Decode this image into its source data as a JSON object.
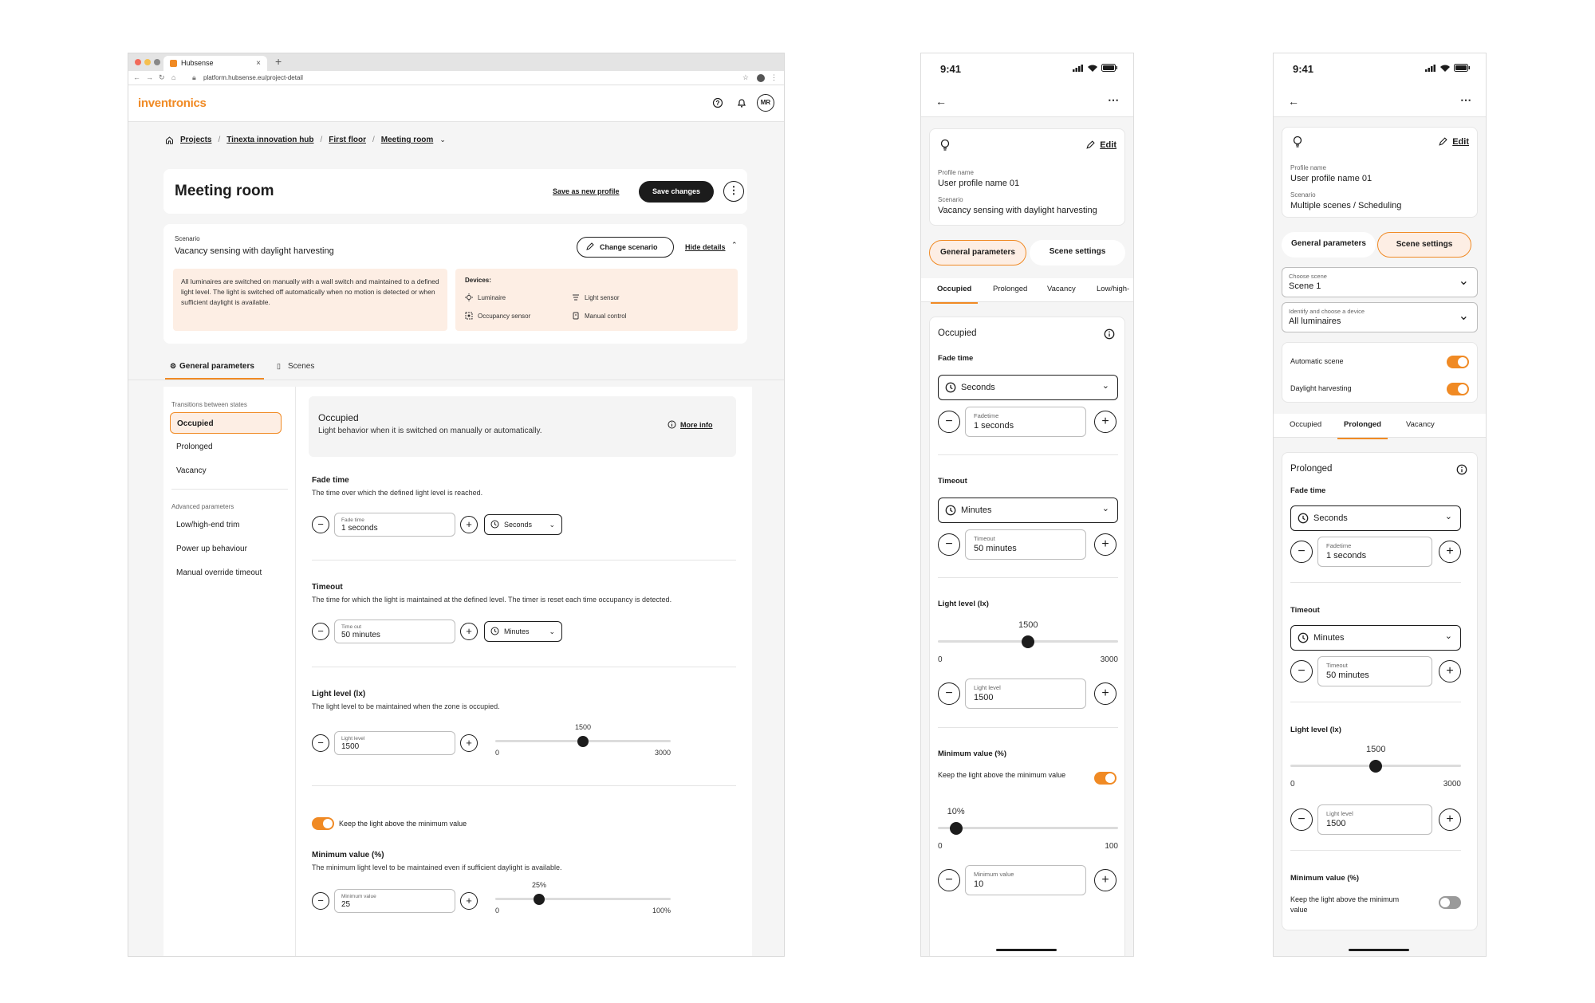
{
  "desktop": {
    "browser": {
      "tab_title": "Hubsense",
      "url": "platform.hubsense.eu/project-detail"
    },
    "logo": "inventronics",
    "avatar": "MR",
    "breadcrumb": [
      "Projects",
      "Tinexta innovation hub",
      "First floor",
      "Meeting room"
    ],
    "page_title": "Meeting room",
    "save_as_new": "Save as new profile",
    "save_changes": "Save changes",
    "scenario": {
      "label": "Scenario",
      "name": "Vacancy sensing with daylight harvesting",
      "change_btn": "Change scenario",
      "hide_btn": "Hide details",
      "description": "All luminaires are switched on manually with a wall switch and maintained to a defined light level. The light is switched off automatically when no motion is detected or when sufficient daylight is available.",
      "devices_label": "Devices:",
      "devices": [
        "Luminaire",
        "Light sensor",
        "Occupancy sensor",
        "Manual control"
      ]
    },
    "tabs": [
      "General parameters",
      "Scenes"
    ],
    "nav": {
      "transitions_header": "Transitions between states",
      "transitions": [
        "Occupied",
        "Prolonged",
        "Vacancy"
      ],
      "advanced_header": "Advanced parameters",
      "advanced": [
        "Low/high-end trim",
        "Power up behaviour",
        "Manual override timeout"
      ]
    },
    "info": {
      "title": "Occupied",
      "desc": "Light behavior when it is switched on manually or automatically.",
      "more": "More info"
    },
    "fade": {
      "title": "Fade time",
      "desc": "The time over which the defined light level is reached.",
      "label": "Fade time",
      "value": "1 seconds",
      "unit": "Seconds"
    },
    "timeout": {
      "title": "Timeout",
      "desc": "The time for which the light is maintained at the defined level. The timer is reset each time occupancy is detected.",
      "label": "Time out",
      "value": "50 minutes",
      "unit": "Minutes"
    },
    "light": {
      "title": "Light level (lx)",
      "desc": "The light level to be maintained when the zone is occupied.",
      "label": "Light level",
      "value": "1500",
      "slider_value": "1500",
      "min": "0",
      "max": "3000",
      "fraction": 0.5
    },
    "keep_toggle": {
      "label": "Keep the light above the minimum value",
      "on": true
    },
    "minimum": {
      "title": "Minimum value (%)",
      "desc": "The minimum light level to be maintained even if sufficient daylight is available.",
      "label": "Minimum value",
      "value": "25",
      "slider_value": "25%",
      "min": "0",
      "max": "100%",
      "fraction": 0.25
    }
  },
  "phone1": {
    "time": "9:41",
    "edit": "Edit",
    "profile_label": "Profile name",
    "profile": "User profile name 01",
    "scenario_label": "Scenario",
    "scenario": "Vacancy sensing with daylight harvesting",
    "seg": [
      "General parameters",
      "Scene settings"
    ],
    "tabs": [
      "Occupied",
      "Prolonged",
      "Vacancy",
      "Low/high-"
    ],
    "card_title": "Occupied",
    "fade": {
      "title": "Fade time",
      "unit": "Seconds",
      "label": "Fadetime",
      "value": "1 seconds"
    },
    "timeout": {
      "title": "Timeout",
      "unit": "Minutes",
      "label": "Timeout",
      "value": "50 minutes"
    },
    "light": {
      "title": "Light level (lx)",
      "slider_value": "1500",
      "min": "0",
      "max": "3000",
      "label": "Light level",
      "value": "1500",
      "fraction": 0.5
    },
    "minimum": {
      "title": "Minimum value (%)",
      "keep": "Keep the light above the minimum value",
      "keep_on": true,
      "slider_value": "10%",
      "min": "0",
      "max": "100",
      "label": "Minimum value",
      "value": "10",
      "fraction": 0.1
    }
  },
  "phone2": {
    "time": "9:41",
    "edit": "Edit",
    "profile_label": "Profile name",
    "profile": "User profile name 01",
    "scenario_label": "Scenario",
    "scenario": "Multiple scenes / Scheduling",
    "seg": [
      "General parameters",
      "Scene settings"
    ],
    "scene_label": "Choose scene",
    "scene": "Scene 1",
    "device_label": "Identify and choose a device",
    "device": "All luminaires",
    "auto_scene": "Automatic scene",
    "auto_on": true,
    "daylight": "Daylight harvesting",
    "daylight_on": true,
    "tabs": [
      "Occupied",
      "Prolonged",
      "Vacancy"
    ],
    "card_title": "Prolonged",
    "fade": {
      "title": "Fade time",
      "unit": "Seconds",
      "label": "Fadetime",
      "value": "1 seconds"
    },
    "timeout": {
      "title": "Timeout",
      "unit": "Minutes",
      "label": "Timeout",
      "value": "50 minutes"
    },
    "light": {
      "title": "Light level (lx)",
      "slider_value": "1500",
      "min": "0",
      "max": "3000",
      "label": "Light level",
      "value": "1500",
      "fraction": 0.5
    },
    "minimum": {
      "title": "Minimum value (%)",
      "keep": "Keep the light above the minimum value",
      "keep_on": false
    }
  },
  "colors": {
    "accent": "#f08a24",
    "accent_bg": "#fdeee4",
    "dark": "#1c1c1c"
  }
}
